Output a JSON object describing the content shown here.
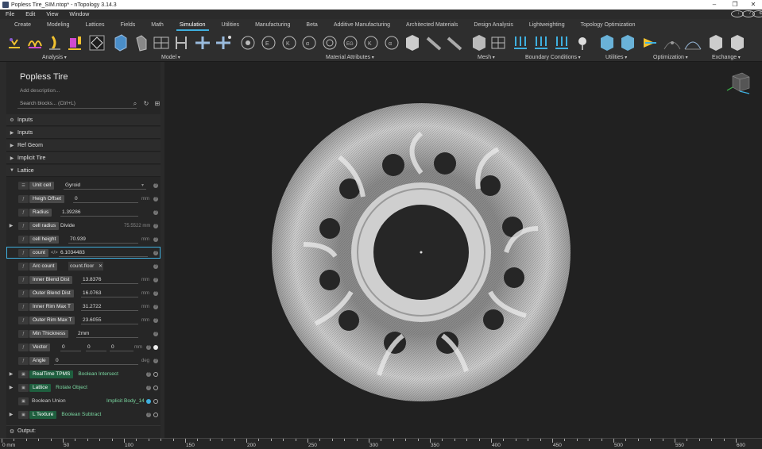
{
  "window": {
    "title": "Popless Tire_SIM.ntop* - nTopology 3.14.3"
  },
  "menu": [
    "File",
    "Edit",
    "View",
    "Window"
  ],
  "tabs": [
    {
      "label": "Create",
      "active": false
    },
    {
      "label": "Modeling",
      "active": false
    },
    {
      "label": "Lattices",
      "active": false
    },
    {
      "label": "Fields",
      "active": false
    },
    {
      "label": "Math",
      "active": false
    },
    {
      "label": "Simulation",
      "active": true
    },
    {
      "label": "Utilities",
      "active": false
    },
    {
      "label": "Manufacturing",
      "active": false
    },
    {
      "label": "Beta",
      "active": false
    },
    {
      "label": "Additive Manufacturing",
      "active": false
    },
    {
      "label": "Architected Materials",
      "active": false
    },
    {
      "label": "Design Analysis",
      "active": false
    },
    {
      "label": "Lightweighting",
      "active": false
    },
    {
      "label": "Topology Optimization",
      "active": false
    }
  ],
  "ribbon_groups": [
    "Analysis",
    "Model",
    "Material Attributes",
    "Mesh",
    "Boundary Conditions",
    "Utilities",
    "Optimization",
    "Exchange"
  ],
  "notebook": {
    "title": "Popless Tire",
    "description_placeholder": "Add description...",
    "search_placeholder": "Search blocks... (Ctrl+L)",
    "sections": [
      "Inputs",
      "Inputs",
      "Ref Geom",
      "Implicit Tire",
      "Lattice"
    ],
    "output_label": "Output:"
  },
  "lattice_rows": [
    {
      "name": "Unit cell",
      "value": "Gyroid",
      "unit": "",
      "type": "dropdown"
    },
    {
      "name": "Heigh Offset",
      "value": "0",
      "unit": "mm"
    },
    {
      "name": "Radius",
      "value": "1.39286",
      "unit": ""
    },
    {
      "name": "cell radius",
      "value": "Divide",
      "unit": "75.5522 mm",
      "expand": true
    },
    {
      "name": "cell height",
      "value": "70.939",
      "unit": "mm"
    },
    {
      "name": "count",
      "value": "6.1034483",
      "unit": "",
      "highlight": true
    },
    {
      "name": "Arc count",
      "value": "count.floor",
      "unit": ""
    },
    {
      "name": "Inner Blend Dist",
      "value": "13.8376",
      "unit": "mm"
    },
    {
      "name": "Outer Blend Dist",
      "value": "16.0763",
      "unit": "mm"
    },
    {
      "name": "Inner Rim Max T",
      "value": "31.2722",
      "unit": "mm"
    },
    {
      "name": "Outer Rim Max T",
      "value": "23.6055",
      "unit": "mm"
    },
    {
      "name": "Min Thickness",
      "value": "2mm",
      "unit": ""
    },
    {
      "name": "Vector",
      "value": "0",
      "value2": "0",
      "value3": "0",
      "unit": "mm"
    },
    {
      "name": "Angle",
      "value": "0",
      "unit": "deg"
    }
  ],
  "block_rows": [
    {
      "name": "RealTime TPMS",
      "block": "Boolean Intersect"
    },
    {
      "name": "Lattice",
      "block": "Rotate Object"
    },
    {
      "name": "Boolean Union",
      "block": "Implicit Body_14"
    },
    {
      "name": "L Texture",
      "block": "Boolean Subtract"
    }
  ],
  "ruler": {
    "labels": [
      "0 mm",
      "50",
      "100",
      "150",
      "200",
      "250",
      "300",
      "350",
      "400",
      "450",
      "500",
      "550",
      "600"
    ]
  },
  "colors": {
    "accent": "#3fb0e0",
    "block_green": "#1f5f3f",
    "tire": "#d8d8d8"
  }
}
